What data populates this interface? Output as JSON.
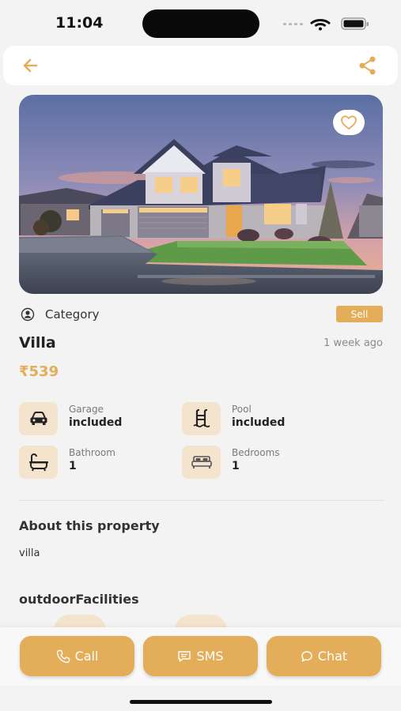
{
  "status_bar": {
    "time": "11:04"
  },
  "header": {
    "back_icon": "arrow-left-icon",
    "share_icon": "share-icon"
  },
  "listing": {
    "category_label": "Category",
    "badge": "Sell",
    "title": "Villa",
    "time_ago": "1 week ago",
    "price": "₹539"
  },
  "features": [
    {
      "icon": "car-icon",
      "label": "Garage",
      "value": "included"
    },
    {
      "icon": "pool-ladder-icon",
      "label": "Pool",
      "value": "included"
    },
    {
      "icon": "bathtub-icon",
      "label": "Bathroom",
      "value": "1"
    },
    {
      "icon": "bed-icon",
      "label": "Bedrooms",
      "value": "1"
    }
  ],
  "about": {
    "title": "About this property",
    "text": "villa"
  },
  "outdoor": {
    "title": "outdoorFacilities"
  },
  "actions": {
    "call": "Call",
    "sms": "SMS",
    "chat": "Chat"
  },
  "colors": {
    "accent": "#e4ad5a",
    "accent_light": "#f5e4cd",
    "background": "#f3f3f3"
  }
}
